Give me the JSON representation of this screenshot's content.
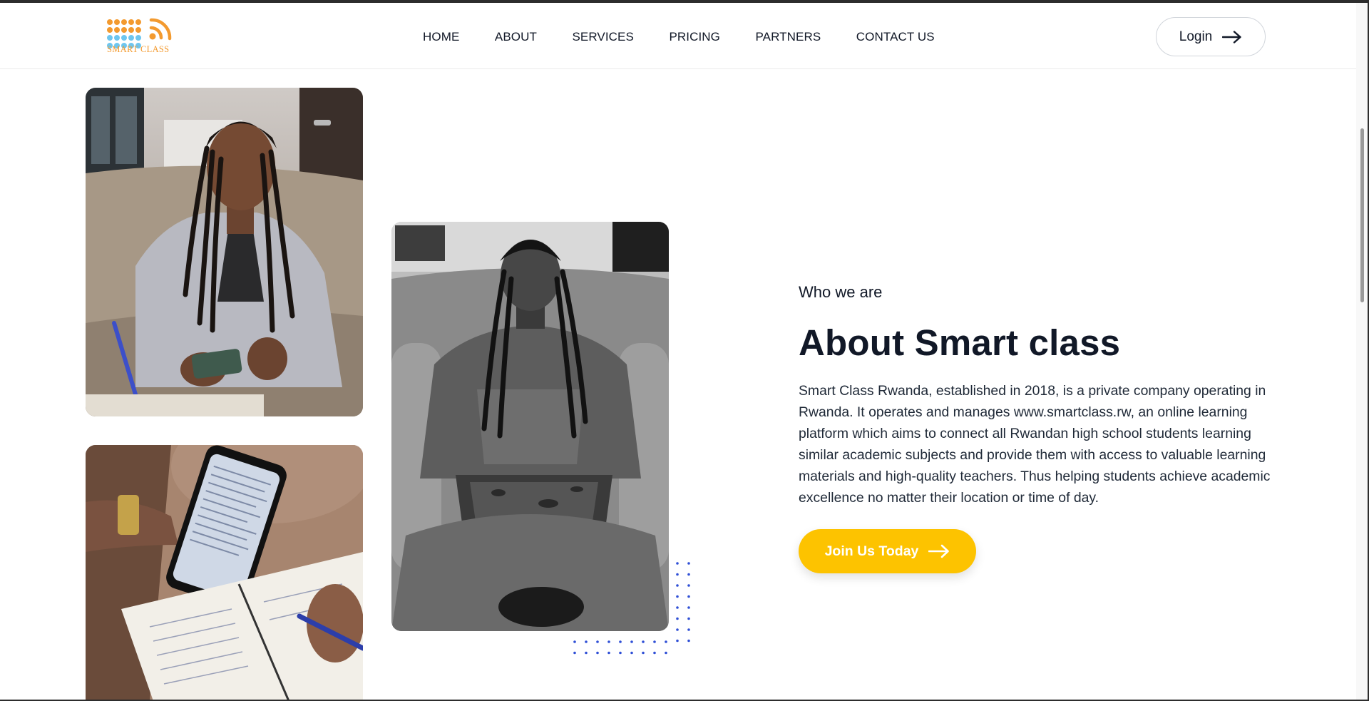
{
  "brand": {
    "logo_text": "SMART CLASS",
    "colors": {
      "orange": "#f39a2f",
      "blue": "#6ec6ef",
      "accent_yellow": "#fdc300",
      "dot_blue": "#2f4fd6"
    }
  },
  "nav": {
    "items": [
      "HOME",
      "ABOUT",
      "SERVICES",
      "PRICING",
      "PARTNERS",
      "CONTACT US"
    ]
  },
  "header": {
    "login_label": "Login",
    "login_icon": "arrow-right-icon"
  },
  "about": {
    "kicker": "Who we are",
    "title": "About Smart class",
    "description": "Smart Class Rwanda, established in 2018, is a private company operating in Rwanda. It operates and manages www.smartclass.rw, an online learning platform which aims to connect all Rwandan high school students learning similar academic subjects and provide them with access to valuable learning materials and high-quality teachers. Thus helping students achieve academic excellence no matter their location or time of day.",
    "cta_label": "Join Us Today",
    "cta_icon": "arrow-right-icon"
  },
  "images": {
    "photo_1": "student-writing-with-phone-photo",
    "photo_2": "student-on-laptop-grayscale-photo",
    "photo_3": "phone-and-notebook-closeup-photo"
  }
}
